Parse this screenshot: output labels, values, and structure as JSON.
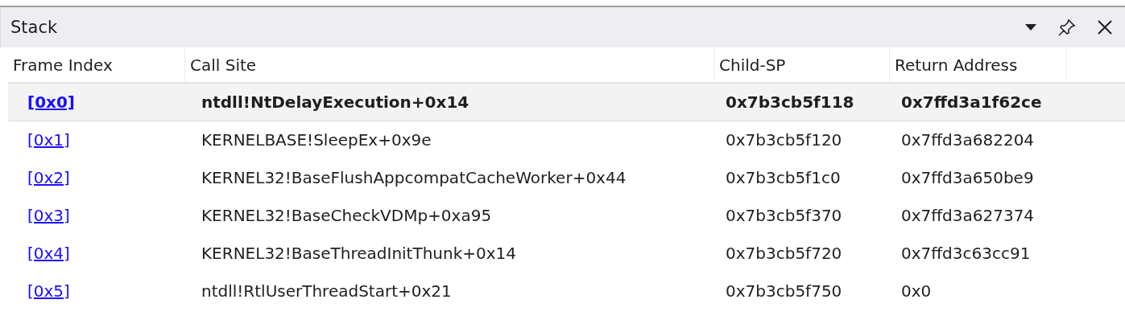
{
  "panel": {
    "title": "Stack"
  },
  "table": {
    "columns": [
      "Frame Index",
      "Call Site",
      "Child-SP",
      "Return Address"
    ],
    "rows": [
      {
        "frame_index": "[0x0]",
        "call_site": "ntdll!NtDelayExecution+0x14",
        "child_sp": "0x7b3cb5f118",
        "return_address": "0x7ffd3a1f62ce",
        "selected": true
      },
      {
        "frame_index": "[0x1]",
        "call_site": "KERNELBASE!SleepEx+0x9e",
        "child_sp": "0x7b3cb5f120",
        "return_address": "0x7ffd3a682204",
        "selected": false
      },
      {
        "frame_index": "[0x2]",
        "call_site": "KERNEL32!BaseFlushAppcompatCacheWorker+0x44",
        "child_sp": "0x7b3cb5f1c0",
        "return_address": "0x7ffd3a650be9",
        "selected": false
      },
      {
        "frame_index": "[0x3]",
        "call_site": "KERNEL32!BaseCheckVDMp+0xa95",
        "child_sp": "0x7b3cb5f370",
        "return_address": "0x7ffd3a627374",
        "selected": false
      },
      {
        "frame_index": "[0x4]",
        "call_site": "KERNEL32!BaseThreadInitThunk+0x14",
        "child_sp": "0x7b3cb5f720",
        "return_address": "0x7ffd3c63cc91",
        "selected": false
      },
      {
        "frame_index": "[0x5]",
        "call_site": "ntdll!RtlUserThreadStart+0x21",
        "child_sp": "0x7b3cb5f750",
        "return_address": "0x0",
        "selected": false
      }
    ]
  }
}
